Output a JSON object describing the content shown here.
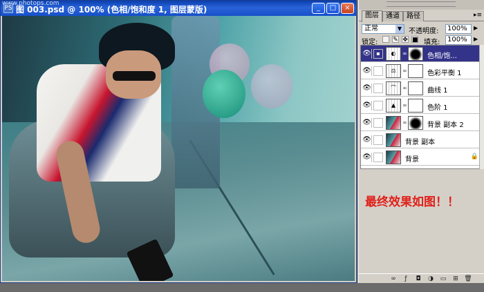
{
  "window": {
    "title": "图 003.psd @ 100% (色相/饱和度 1, 图层蒙版)",
    "watermark": "www.photops.com",
    "app_icon": "PS",
    "buttons": [
      "_",
      "□",
      "×"
    ]
  },
  "panel": {
    "tabs": [
      "图层",
      "通道",
      "路径"
    ],
    "blend_mode": "正常",
    "opacity_label": "不透明度:",
    "opacity_value": "100%",
    "lock_label": "锁定:",
    "fill_label": "填充:",
    "fill_value": "100%",
    "layers": [
      {
        "name": "色相/饱...",
        "selected": true,
        "has_mask": true,
        "mask_dark": true,
        "type": "adjustment"
      },
      {
        "name": "色彩平衡 1",
        "selected": false,
        "has_mask": true,
        "mask_dark": false,
        "type": "adjustment"
      },
      {
        "name": "曲线 1",
        "selected": false,
        "has_mask": true,
        "mask_dark": false,
        "type": "adjustment"
      },
      {
        "name": "色阶 1",
        "selected": false,
        "has_mask": true,
        "mask_dark": false,
        "type": "adjustment"
      },
      {
        "name": "背景 副本 2",
        "selected": false,
        "has_mask": true,
        "mask_dark": true,
        "type": "photo"
      },
      {
        "name": "背景 副本",
        "selected": false,
        "has_mask": false,
        "mask_dark": false,
        "type": "photo"
      },
      {
        "name": "背景",
        "selected": false,
        "has_mask": false,
        "mask_dark": false,
        "type": "photo",
        "locked": true
      }
    ]
  },
  "note": "最终效果如图！！",
  "colors": {
    "note": "#e0201a",
    "titlebar": "#1650c9",
    "selection": "#33338a"
  }
}
